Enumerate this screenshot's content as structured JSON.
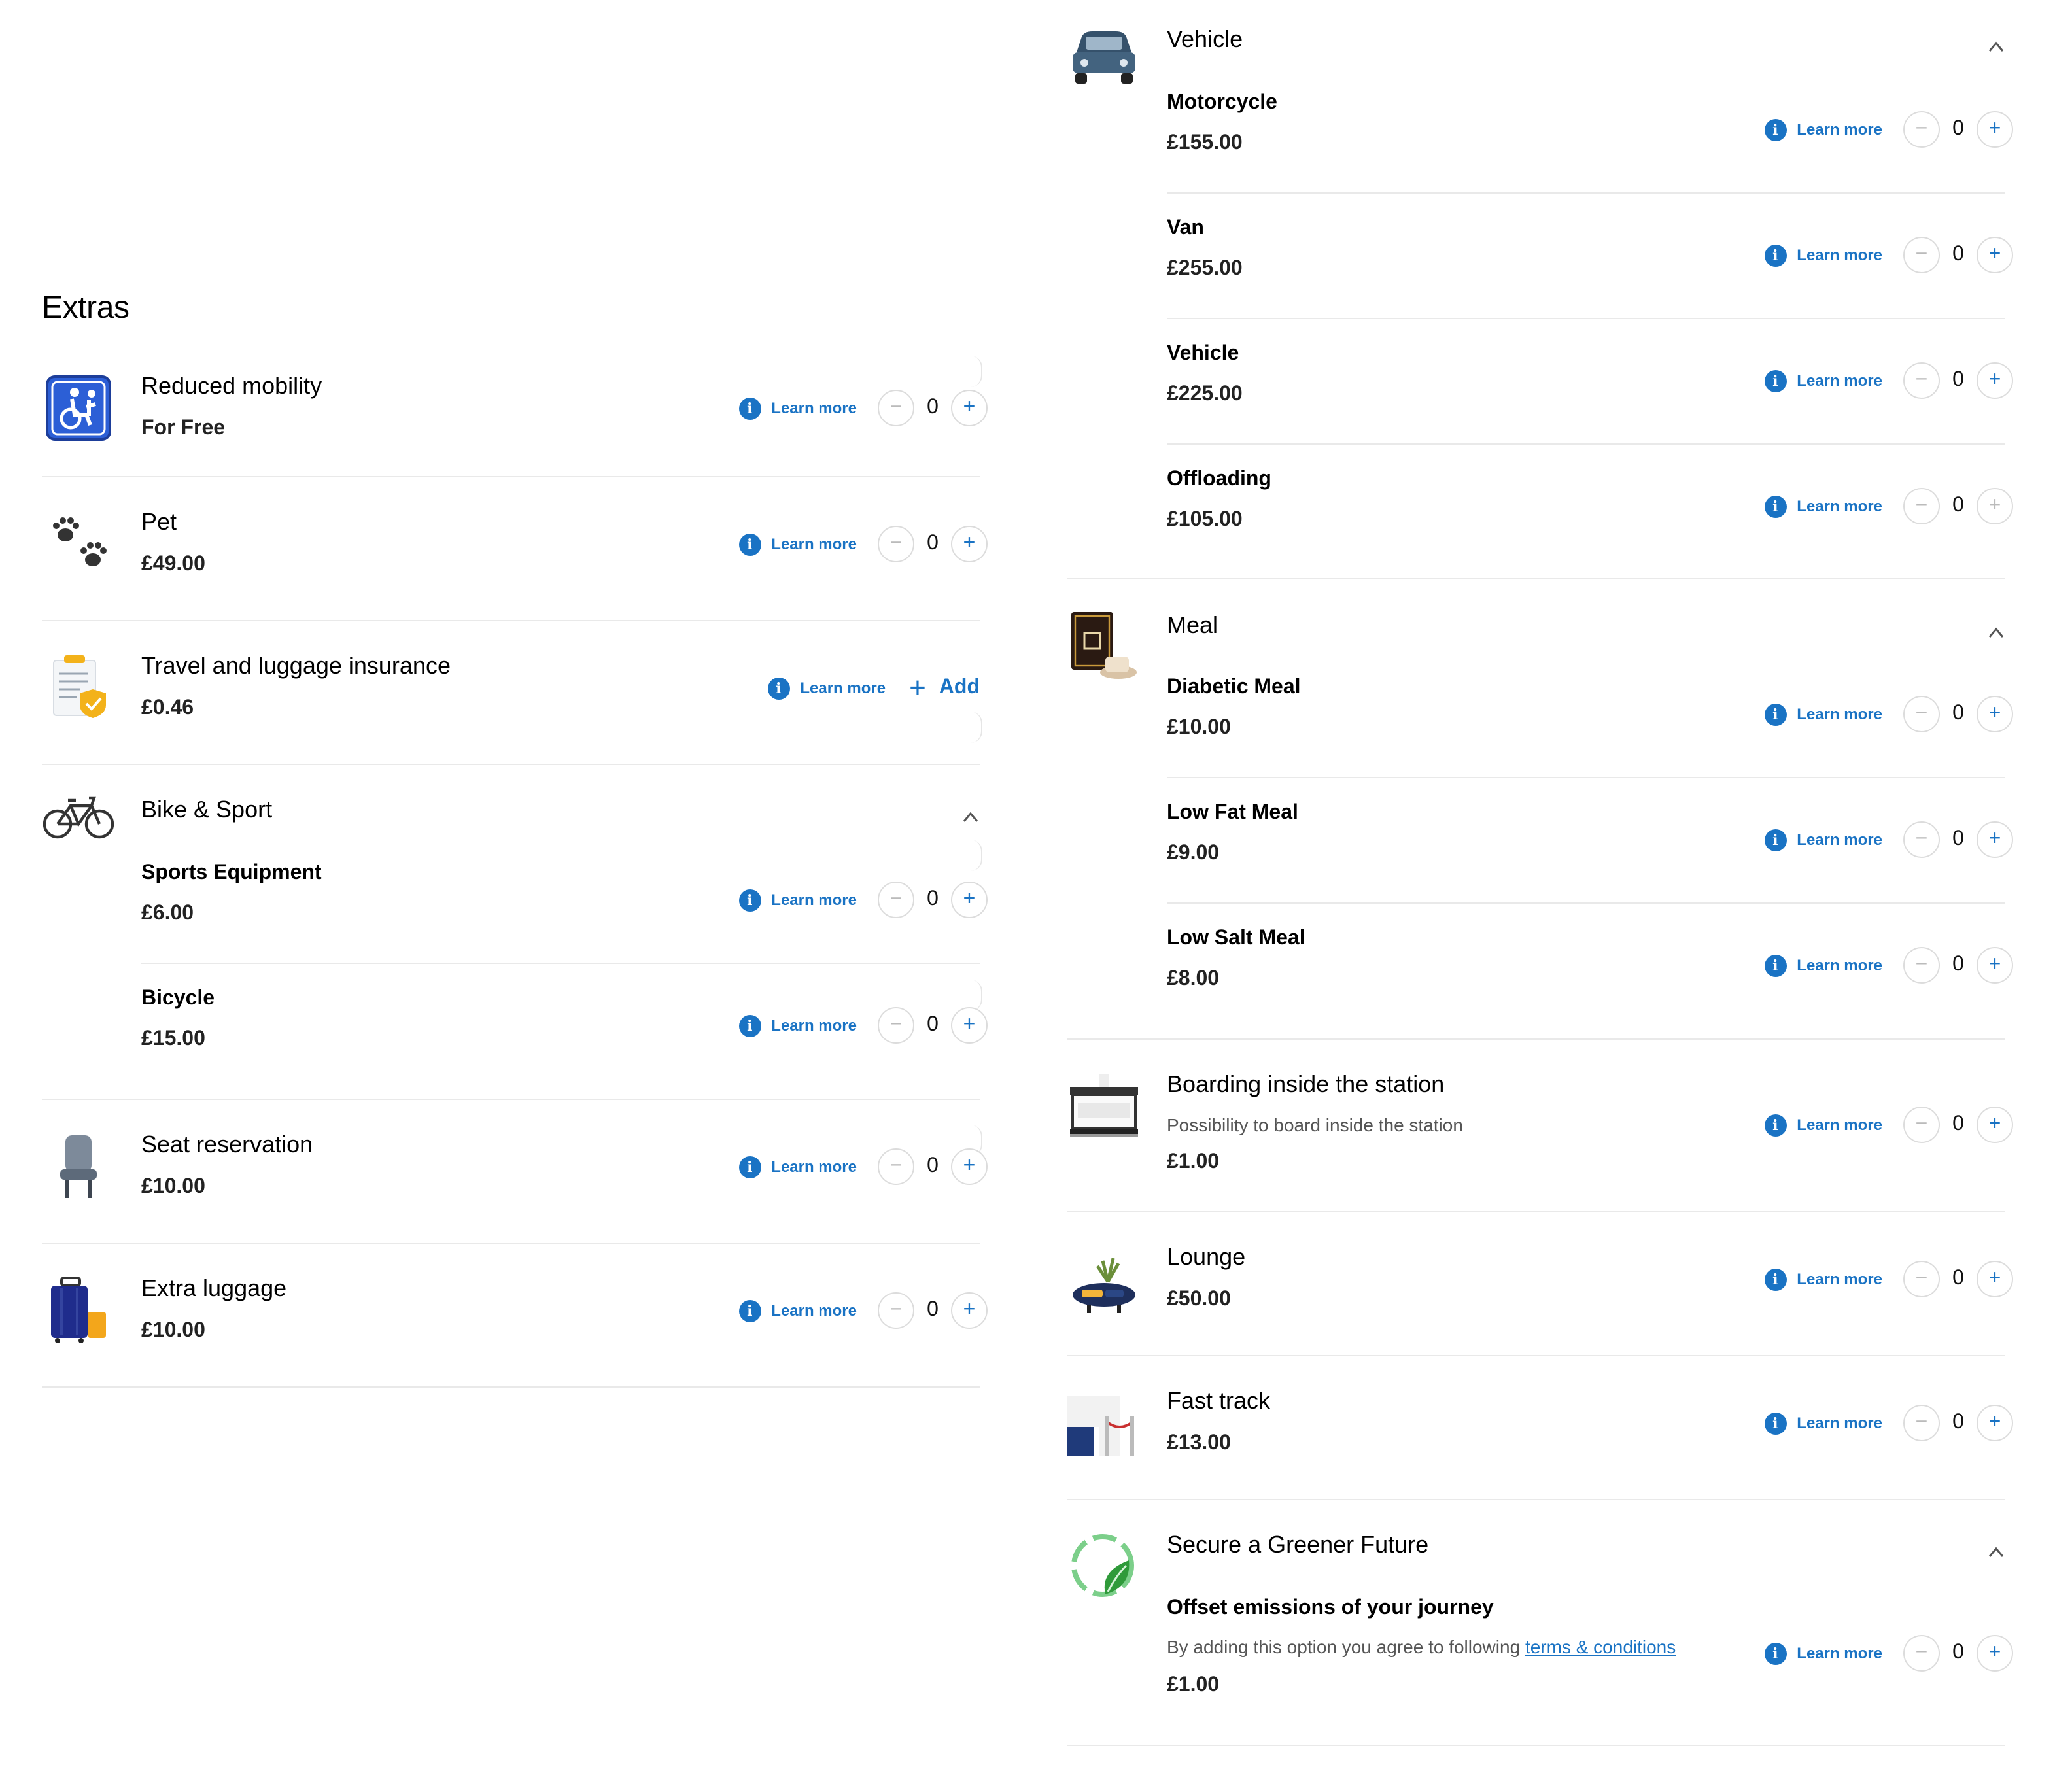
{
  "extras_title": "Extras",
  "learn_more": "Learn more",
  "add_label": "Add",
  "colors": {
    "accent": "#1a73c4",
    "divider": "#e9e9e9"
  },
  "left": {
    "reduced_mobility": {
      "title": "Reduced mobility",
      "price": "For Free",
      "qty": "0",
      "icon": "wheelchair-icon"
    },
    "pet": {
      "title": "Pet",
      "price": "£49.00",
      "qty": "0",
      "icon": "paw-icon"
    },
    "insurance": {
      "title": "Travel and luggage insurance",
      "price": "£0.46",
      "icon": "insurance-document-icon"
    },
    "bike_sport": {
      "title": "Bike & Sport",
      "icon": "bicycle-icon",
      "items": [
        {
          "name": "Sports Equipment",
          "price": "£6.00",
          "qty": "0"
        },
        {
          "name": "Bicycle",
          "price": "£15.00",
          "qty": "0"
        }
      ]
    },
    "seat": {
      "title": "Seat reservation",
      "price": "£10.00",
      "qty": "0",
      "icon": "seat-icon"
    },
    "luggage": {
      "title": "Extra luggage",
      "price": "£10.00",
      "qty": "0",
      "icon": "suitcase-icon"
    }
  },
  "right": {
    "vehicle": {
      "title": "Vehicle",
      "icon": "car-icon",
      "items": [
        {
          "name": "Motorcycle",
          "price": "£155.00",
          "qty": "0"
        },
        {
          "name": "Van",
          "price": "£255.00",
          "qty": "0"
        },
        {
          "name": "Vehicle",
          "price": "£225.00",
          "qty": "0"
        },
        {
          "name": "Offloading",
          "price": "£105.00",
          "qty": "0"
        }
      ]
    },
    "meal": {
      "title": "Meal",
      "icon": "meal-tray-icon",
      "items": [
        {
          "name": "Diabetic Meal",
          "price": "£10.00",
          "qty": "0"
        },
        {
          "name": "Low Fat Meal",
          "price": "£9.00",
          "qty": "0"
        },
        {
          "name": "Low Salt Meal",
          "price": "£8.00",
          "qty": "0"
        }
      ]
    },
    "boarding": {
      "title": "Boarding inside the station",
      "desc": "Possibility to board inside the station",
      "price": "£1.00",
      "qty": "0",
      "icon": "boarding-gate-icon"
    },
    "lounge": {
      "title": "Lounge",
      "price": "£50.00",
      "qty": "0",
      "icon": "lounge-icon"
    },
    "fast_track": {
      "title": "Fast track",
      "price": "£13.00",
      "qty": "0",
      "icon": "fast-track-icon"
    },
    "greener": {
      "title": "Secure a Greener Future",
      "icon": "leaf-globe-icon",
      "item_name": "Offset emissions of your journey",
      "desc_prefix": "By adding this option you agree to following",
      "terms_link": "terms & conditions",
      "price": "£1.00",
      "qty": "0"
    }
  }
}
